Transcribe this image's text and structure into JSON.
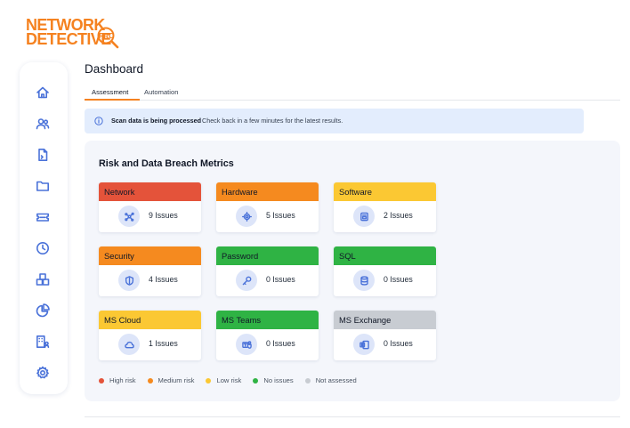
{
  "logo": {
    "line1": "NETWORK",
    "line2": "DETECTIVE",
    "badge": "PRO",
    "color": "#f58220"
  },
  "sidebar": {
    "items": [
      {
        "icon": "home-icon"
      },
      {
        "icon": "users-icon"
      },
      {
        "icon": "document-icon"
      },
      {
        "icon": "folder-icon"
      },
      {
        "icon": "ticket-icon"
      },
      {
        "icon": "clock-icon"
      },
      {
        "icon": "boxes-icon"
      },
      {
        "icon": "pie-chart-icon"
      },
      {
        "icon": "building-icon"
      },
      {
        "icon": "settings-icon"
      }
    ]
  },
  "header": {
    "title": "Dashboard",
    "tabs": [
      {
        "label": "Assessment",
        "active": true
      },
      {
        "label": "Automation",
        "active": false
      }
    ]
  },
  "banner": {
    "bold": "Scan data is being processed",
    "text": "Check back in a few minutes for the latest results."
  },
  "metrics": {
    "title": "Risk and Data Breach Metrics",
    "cards": [
      {
        "name": "Network",
        "count": "9 Issues",
        "color": "#e4533a",
        "icon": "network-icon"
      },
      {
        "name": "Hardware",
        "count": "5 Issues",
        "color": "#f58a1f",
        "icon": "cpu-icon"
      },
      {
        "name": "Software",
        "count": "2 Issues",
        "color": "#fbc833",
        "icon": "app-icon"
      },
      {
        "name": "Security",
        "count": "4 Issues",
        "color": "#f58a1f",
        "icon": "shield-icon"
      },
      {
        "name": "Password",
        "count": "0 Issues",
        "color": "#2fb344",
        "icon": "key-icon"
      },
      {
        "name": "SQL",
        "count": "0 Issues",
        "color": "#2fb344",
        "icon": "database-icon"
      },
      {
        "name": "MS Cloud",
        "count": "1 Issues",
        "color": "#fbc833",
        "icon": "cloud-icon"
      },
      {
        "name": "MS Teams",
        "count": "0 Issues",
        "color": "#2fb344",
        "icon": "teams-icon"
      },
      {
        "name": "MS Exchange",
        "count": "0 Issues",
        "color": "#c8ccd2",
        "icon": "exchange-icon"
      }
    ],
    "legend": [
      {
        "label": "High risk",
        "color": "#e4533a"
      },
      {
        "label": "Medium risk",
        "color": "#f58a1f"
      },
      {
        "label": "Low risk",
        "color": "#fbc833"
      },
      {
        "label": "No issues",
        "color": "#2fb344"
      },
      {
        "label": "Not assessed",
        "color": "#c8ccd2"
      }
    ]
  }
}
